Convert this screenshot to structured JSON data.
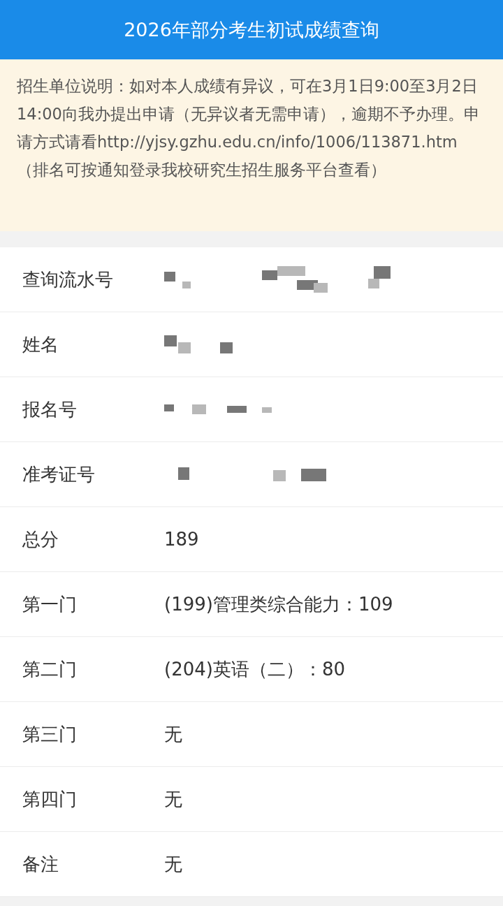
{
  "header": {
    "title": "2026年部分考生初试成绩查询"
  },
  "notice": {
    "text": "招生单位说明：如对本人成绩有异议，可在3月1日9:00至3月2日14:00向我办提出申请（无异议者无需申请），逾期不予办理。申请方式请看http://yjsy.gzhu.edu.cn/info/1006/113871.htm（排名可按通知登录我校研究生招生服务平台查看）"
  },
  "rows": [
    {
      "label": "查询流水号",
      "kind": "redacted"
    },
    {
      "label": "姓名",
      "kind": "redacted"
    },
    {
      "label": "报名号",
      "kind": "redacted"
    },
    {
      "label": "准考证号",
      "kind": "redacted"
    },
    {
      "label": "总分",
      "kind": "text",
      "value": "189"
    },
    {
      "label": "第一门",
      "kind": "text",
      "value": "(199)管理类综合能力：109"
    },
    {
      "label": "第二门",
      "kind": "text",
      "value": "(204)英语（二）：80"
    },
    {
      "label": "第三门",
      "kind": "text",
      "value": "无"
    },
    {
      "label": "第四门",
      "kind": "text",
      "value": "无"
    },
    {
      "label": "备注",
      "kind": "text",
      "value": "无"
    }
  ]
}
